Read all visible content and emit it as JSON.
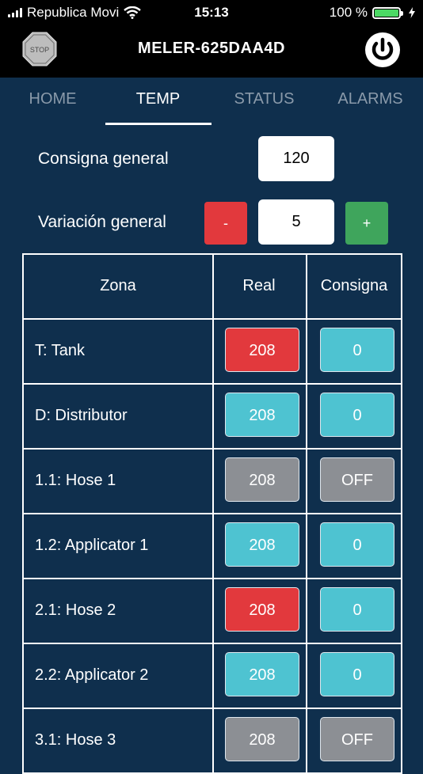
{
  "status_bar": {
    "carrier": "Republica Movi",
    "time": "15:13",
    "battery_text": "100 %",
    "icons": [
      "signal-icon",
      "wifi-icon",
      "battery-icon",
      "charging-bolt-icon"
    ]
  },
  "header": {
    "title": "MELER-625DAA4D",
    "stop_label": "STOP",
    "stop_icon": "stop-sign-icon",
    "power_icon": "power-icon"
  },
  "tabs": [
    {
      "label": "HOME",
      "active": false
    },
    {
      "label": "TEMP",
      "active": true
    },
    {
      "label": "STATUS",
      "active": false
    },
    {
      "label": "ALARMS",
      "active": false
    }
  ],
  "form": {
    "consigna_label": "Consigna general",
    "consigna_value": "120",
    "variacion_label": "Variación general",
    "variacion_value": "5",
    "minus_label": "-",
    "plus_label": "+"
  },
  "table": {
    "headers": [
      "Zona",
      "Real",
      "Consigna"
    ],
    "rows": [
      {
        "zone": "T: Tank",
        "real": "208",
        "real_color": "red",
        "consigna": "0",
        "consigna_color": "cyan"
      },
      {
        "zone": "D: Distributor",
        "real": "208",
        "real_color": "cyan",
        "consigna": "0",
        "consigna_color": "cyan"
      },
      {
        "zone": "1.1: Hose 1",
        "real": "208",
        "real_color": "gray",
        "consigna": "OFF",
        "consigna_color": "gray"
      },
      {
        "zone": "1.2: Applicator 1",
        "real": "208",
        "real_color": "cyan",
        "consigna": "0",
        "consigna_color": "cyan"
      },
      {
        "zone": "2.1: Hose 2",
        "real": "208",
        "real_color": "red",
        "consigna": "0",
        "consigna_color": "cyan"
      },
      {
        "zone": "2.2: Applicator 2",
        "real": "208",
        "real_color": "cyan",
        "consigna": "0",
        "consigna_color": "cyan"
      },
      {
        "zone": "3.1: Hose 3",
        "real": "208",
        "real_color": "gray",
        "consigna": "OFF",
        "consigna_color": "gray"
      }
    ]
  },
  "colors": {
    "background": "#0f2f4d",
    "header_bg": "#000000",
    "red": "#e2393d",
    "cyan": "#4ec3d1",
    "gray": "#8c8f94",
    "green": "#3fa55c"
  }
}
